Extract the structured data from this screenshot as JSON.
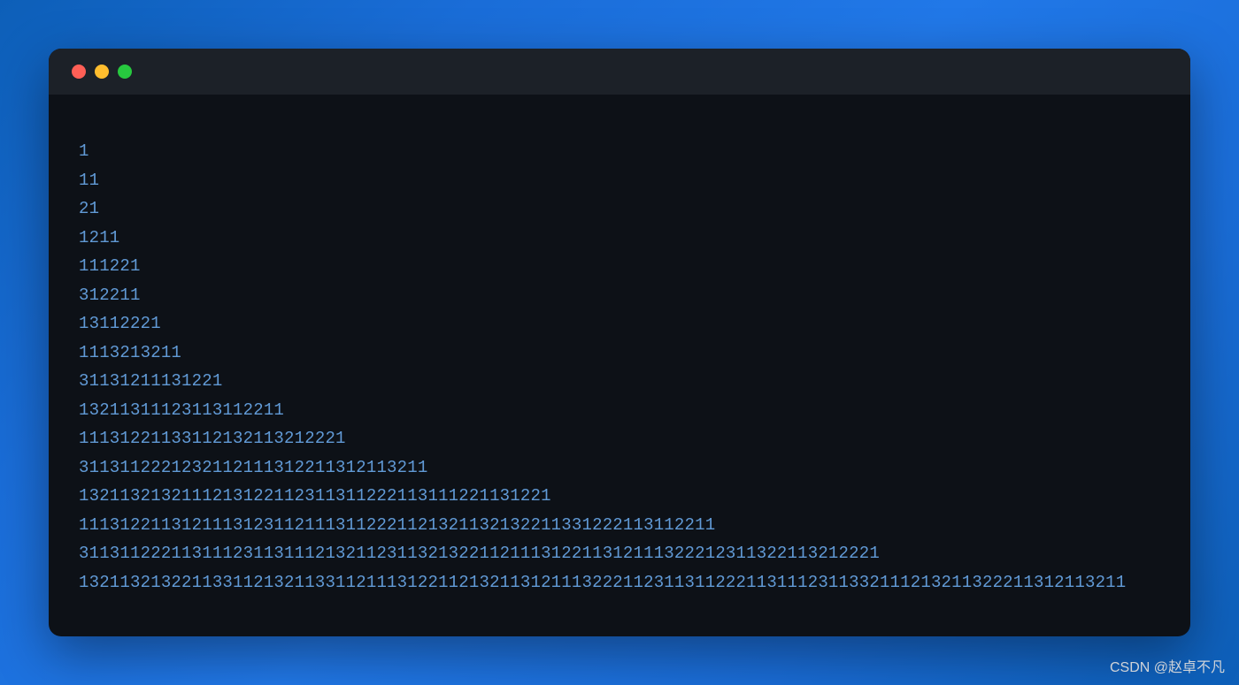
{
  "lines": [
    "1",
    "11",
    "21",
    "1211",
    "111221",
    "312211",
    "13112221",
    "1113213211",
    "31131211131221",
    "13211311123113112211",
    "11131221133112132113212221",
    "3113112221232112111312211312113211",
    "1321132132111213122112311311222113111221131221",
    "11131221131211131231121113112221121321132132211331222113112211",
    "311311222113111231131112132112311321322112111312211312111322212311322113212221",
    "132113213221133112132113311211131221121321131211132221123113112221131112311332111213211322211312113211"
  ],
  "watermark": "CSDN @赵卓不凡"
}
